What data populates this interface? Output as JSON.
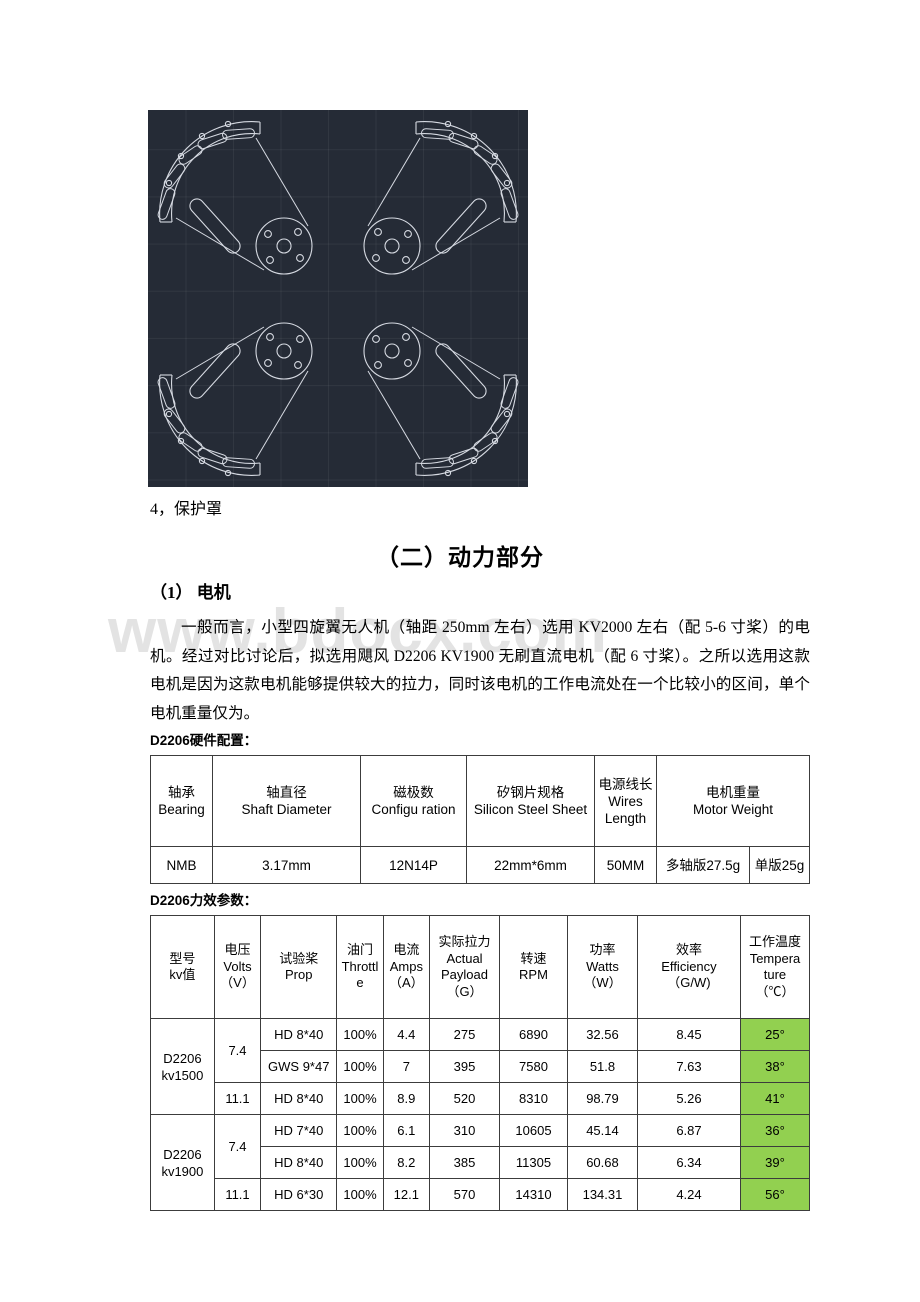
{
  "figure": {
    "name": "propeller-guard-cad-drawing",
    "background_color": "#252b36",
    "line_color": "#d6dae2",
    "caption": "4，保护罩"
  },
  "headings": {
    "section": "（二）动力部分",
    "subsection": "（1） 电机"
  },
  "body": {
    "paragraph": "一般而言，小型四旋翼无人机（轴距 250mm 左右）选用 KV2000 左右（配 5-6 寸桨）的电机。经过对比讨论后，拟选用飓风 D2206 KV1900 无刷直流电机（配 6 寸桨）。之所以选用这款电机是因为这款电机能够提供较大的拉力，同时该电机的工作电流处在一个比较小的区间，单个电机重量仅为。"
  },
  "watermark": {
    "text": "www.bdocx.com",
    "color": "#e3e3e3"
  },
  "hardware_table": {
    "label": "D2206硬件配置：",
    "headers": [
      {
        "zh": "轴承",
        "en": "Bearing"
      },
      {
        "zh": "轴直径",
        "en": "Shaft Diameter"
      },
      {
        "zh": "磁极数",
        "en": "Configu ration"
      },
      {
        "zh": "矽钢片规格",
        "en": "Silicon Steel Sheet"
      },
      {
        "zh": "电源线长",
        "en": "Wires Length"
      },
      {
        "zh": "电机重量",
        "en": "Motor Weight"
      }
    ],
    "row": [
      "NMB",
      "3.17mm",
      "12N14P",
      "22mm*6mm",
      "50MM",
      "多轴版27.5g",
      "单版25g"
    ]
  },
  "performance_table": {
    "label": "D2206力效参数：",
    "highlight_color": "#92d050",
    "headers": [
      {
        "zh": "型号",
        "en": "kv值",
        "unit": ""
      },
      {
        "zh": "电压",
        "en": "Volts",
        "unit": "（V）"
      },
      {
        "zh": "试验桨",
        "en": "Prop",
        "unit": ""
      },
      {
        "zh": "油门",
        "en": "Throttl e",
        "unit": ""
      },
      {
        "zh": "电流",
        "en": "Amps",
        "unit": "（A）"
      },
      {
        "zh": "实际拉力",
        "en": "Actual Payload",
        "unit": "（G）"
      },
      {
        "zh": "转速",
        "en": "RPM",
        "unit": ""
      },
      {
        "zh": "功率",
        "en": "Watts",
        "unit": "（W）"
      },
      {
        "zh": "效率",
        "en": "Efficiency",
        "unit": "（G/W)"
      },
      {
        "zh": "工作温度",
        "en": "Tempera ture",
        "unit": "（℃）"
      }
    ],
    "groups": [
      {
        "model": "D2206 kv1500",
        "rows": [
          {
            "volts": "7.4",
            "volts_span": 2,
            "prop": "HD 8*40",
            "throttle": "100%",
            "amps": "4.4",
            "payload": "275",
            "rpm": "6890",
            "watts": "32.56",
            "efficiency": "8.45",
            "temp": "25°"
          },
          {
            "volts": null,
            "prop": "GWS  9*47",
            "throttle": "100%",
            "amps": "7",
            "payload": "395",
            "rpm": "7580",
            "watts": "51.8",
            "efficiency": "7.63",
            "temp": "38°"
          },
          {
            "volts": "11.1",
            "volts_span": 1,
            "prop": "HD 8*40",
            "throttle": "100%",
            "amps": "8.9",
            "payload": "520",
            "rpm": "8310",
            "watts": "98.79",
            "efficiency": "5.26",
            "temp": "41°"
          }
        ]
      },
      {
        "model": "D2206 kv1900",
        "rows": [
          {
            "volts": "7.4",
            "volts_span": 2,
            "prop": "HD 7*40",
            "throttle": "100%",
            "amps": "6.1",
            "payload": "310",
            "rpm": "10605",
            "watts": "45.14",
            "efficiency": "6.87",
            "temp": "36°"
          },
          {
            "volts": null,
            "prop": "HD 8*40",
            "throttle": "100%",
            "amps": "8.2",
            "payload": "385",
            "rpm": "11305",
            "watts": "60.68",
            "efficiency": "6.34",
            "temp": "39°"
          },
          {
            "volts": "11.1",
            "volts_span": 1,
            "prop": "HD 6*30",
            "throttle": "100%",
            "amps": "12.1",
            "payload": "570",
            "rpm": "14310",
            "watts": "134.31",
            "efficiency": "4.24",
            "temp": "56°"
          }
        ]
      }
    ]
  }
}
